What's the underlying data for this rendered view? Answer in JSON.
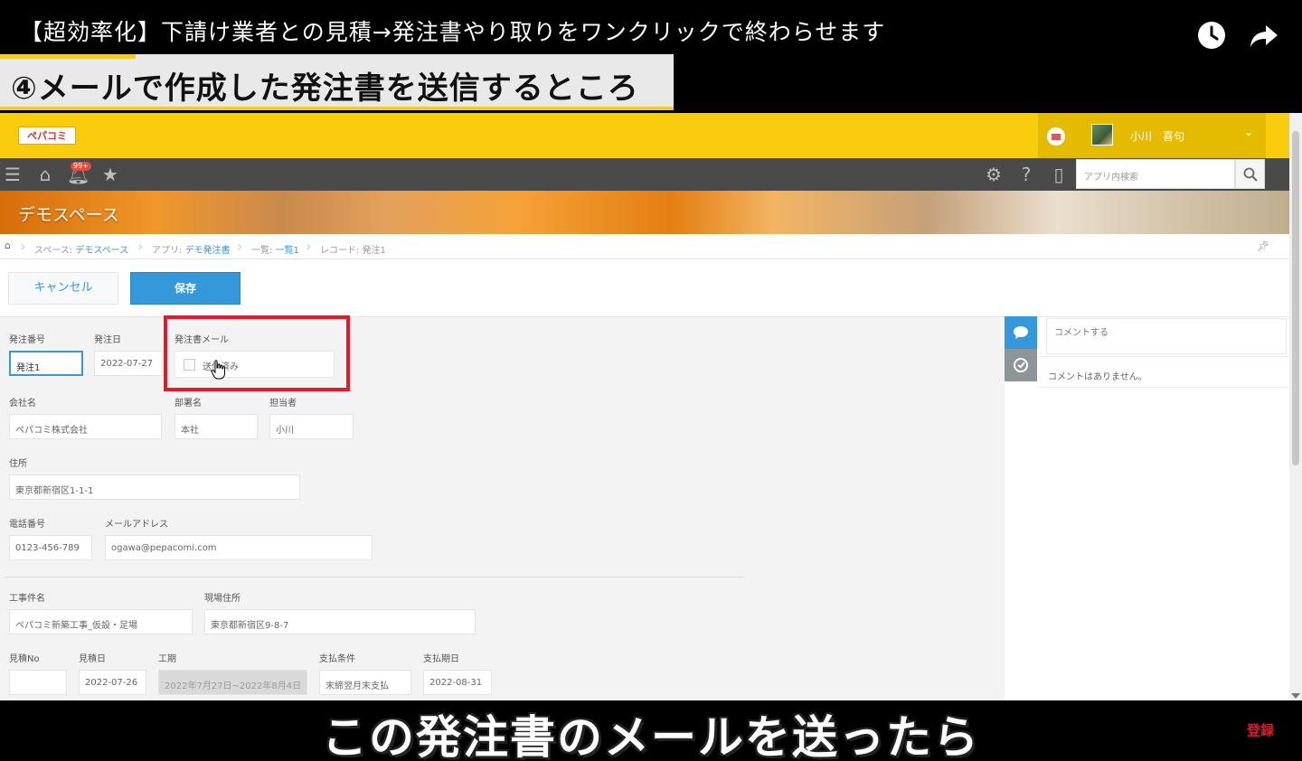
{
  "video": {
    "title": "【超効率化】下請け業者との見積→発注書やり取りをワンクリックで終わらせます",
    "step_banner": "④メールで作成した発注書を送信するところ",
    "subtitle": "この発注書のメールを送ったら",
    "subscribe_label": "登録"
  },
  "header": {
    "logo_text": "ペパコミ",
    "user_name": "小川　喜句"
  },
  "toolbar": {
    "notification_badge": "99+",
    "search_placeholder": "アプリ内検索"
  },
  "space": {
    "title": "デモスペース"
  },
  "breadcrumb": {
    "space_prefix": "スペース: ",
    "space_link": "デモスペース",
    "app_prefix": "アプリ: ",
    "app_link": "デモ発注書",
    "list_prefix": "一覧: ",
    "list_link": "一覧1",
    "record_label": "レコード: 発注1"
  },
  "actions": {
    "cancel_label": "キャンセル",
    "save_label": "保存"
  },
  "form": {
    "order_no": {
      "label": "発注番号",
      "value": "発注1"
    },
    "order_date": {
      "label": "発注日",
      "value": "2022-07-27"
    },
    "order_mail": {
      "label": "発注書メール",
      "option": "送信済み",
      "checked": false
    },
    "company": {
      "label": "会社名",
      "value": "ペパコミ株式会社"
    },
    "department": {
      "label": "部署名",
      "value": "本社"
    },
    "person": {
      "label": "担当者",
      "value": "小川"
    },
    "address": {
      "label": "住所",
      "value": "東京都新宿区1-1-1"
    },
    "phone": {
      "label": "電話番号",
      "value": "0123-456-789"
    },
    "email": {
      "label": "メールアドレス",
      "value": "ogawa@pepacomi.com"
    },
    "project_name": {
      "label": "工事件名",
      "value": "ペパコミ新築工事_仮設・足場"
    },
    "site_address": {
      "label": "現場住所",
      "value": "東京都新宿区9-8-7"
    },
    "estimate_no": {
      "label": "見積No",
      "value": ""
    },
    "estimate_date": {
      "label": "見積日",
      "value": "2022-07-26"
    },
    "period": {
      "label": "工期",
      "value": "2022年7月27日~2022年8月4日"
    },
    "payment_terms": {
      "label": "支払条件",
      "value": "末締翌月末支払"
    },
    "payment_date": {
      "label": "支払期日",
      "value": "2022-08-31"
    }
  },
  "comments": {
    "input_placeholder": "コメントする",
    "empty_text": "コメントはありません。"
  },
  "colors": {
    "header_yellow": "#f9cd0b",
    "accent_blue": "#3498db",
    "highlight_red": "#e8182a"
  }
}
